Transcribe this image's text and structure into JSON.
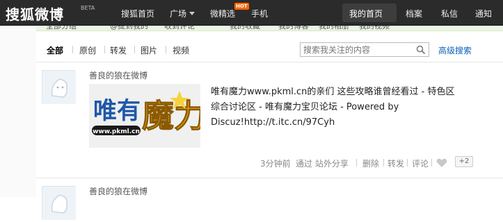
{
  "topnav": {
    "logo": "搜狐微博",
    "beta": "BETA",
    "links": [
      "搜狐首页",
      "广场",
      "微精选",
      "手机"
    ],
    "hot_badge": "HOT",
    "right_links": [
      "我的首页",
      "档案",
      "私信",
      "通知"
    ]
  },
  "subbar": {
    "items": [
      "全部分组",
      "@提到我的",
      "收到评论",
      "我的收藏",
      "我的博客",
      "我的相册",
      "我的视频"
    ]
  },
  "tabs": [
    "全部",
    "原创",
    "转发",
    "图片",
    "视频"
  ],
  "search": {
    "placeholder": "搜索我关注的内容",
    "advanced": "高级搜索"
  },
  "post": {
    "author": "善良的狼在微博",
    "image_caption": "唯有魔力",
    "image_url_text": "www.pkml.cn",
    "text": "唯有魔力www.pkml.cn的亲们 这些攻略谁曾经看过 - 特色区综合讨论区 - 唯有魔力宝贝论坛 - Powered by Discuz!http://t.itc.cn/97Cyh",
    "meta": {
      "time": "3分钟前",
      "source": "通过 站外分享",
      "delete": "删除",
      "forward": "转发",
      "comment": "评论",
      "plus": "+2"
    }
  },
  "post2": {
    "author": "善良的狼在微博"
  },
  "colors": {
    "topbar": "#2b2b2b",
    "link_blue": "#0b61b9",
    "subbar_green": "#eaf5e3"
  }
}
